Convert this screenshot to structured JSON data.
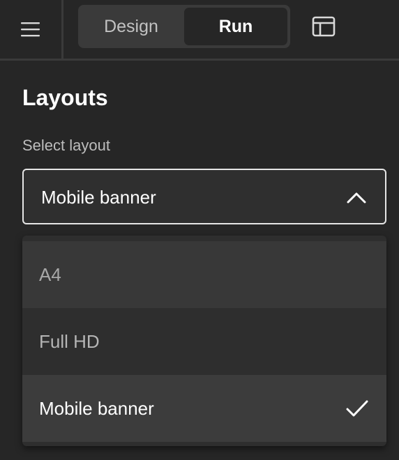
{
  "topbar": {
    "menu_icon": "hamburger-menu-icon",
    "mode_tabs": [
      {
        "label": "Design",
        "selected": false
      },
      {
        "label": "Run",
        "selected": true
      }
    ],
    "layout_icon": "layout-panel-icon"
  },
  "panel": {
    "title": "Layouts",
    "select_label": "Select layout",
    "selected_value": "Mobile banner",
    "dropdown_open": true,
    "options": [
      {
        "label": "A4",
        "selected": false
      },
      {
        "label": "Full HD",
        "selected": false
      },
      {
        "label": "Mobile banner",
        "selected": true
      }
    ]
  },
  "colors": {
    "background": "#262626",
    "surface": "#3a3a3a",
    "text": "#ffffff",
    "muted_text": "#bdbdbd"
  }
}
